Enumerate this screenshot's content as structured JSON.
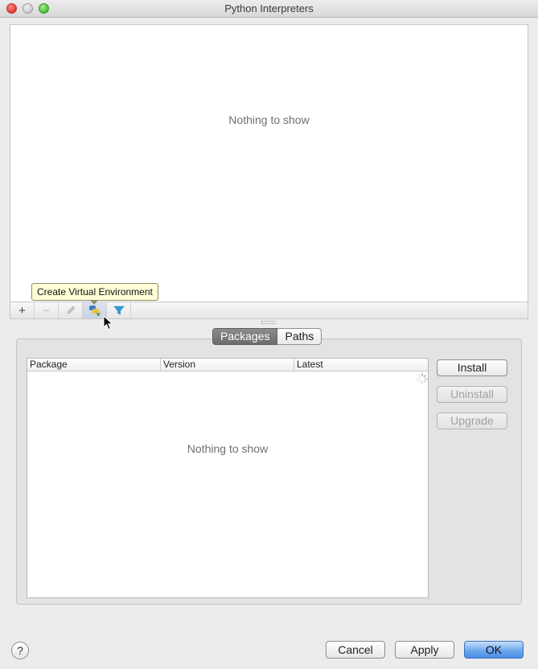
{
  "window": {
    "title": "Python Interpreters"
  },
  "interpreters": {
    "empty_text": "Nothing to show",
    "toolbar": {
      "add": "+",
      "remove": "−",
      "tooltip": "Create Virtual Environment"
    }
  },
  "packages": {
    "tabs": [
      {
        "label": "Packages",
        "active": true
      },
      {
        "label": "Paths",
        "active": false
      }
    ],
    "columns": [
      "Package",
      "Version",
      "Latest"
    ],
    "empty_text": "Nothing to show",
    "buttons": {
      "install": "Install",
      "uninstall": "Uninstall",
      "upgrade": "Upgrade"
    }
  },
  "footer": {
    "help": "?",
    "cancel": "Cancel",
    "apply": "Apply",
    "ok": "OK"
  },
  "colors": {
    "accent": "#4b8ee6",
    "tooltip_bg": "#fffed6",
    "filter_icon": "#2aa0d6"
  }
}
